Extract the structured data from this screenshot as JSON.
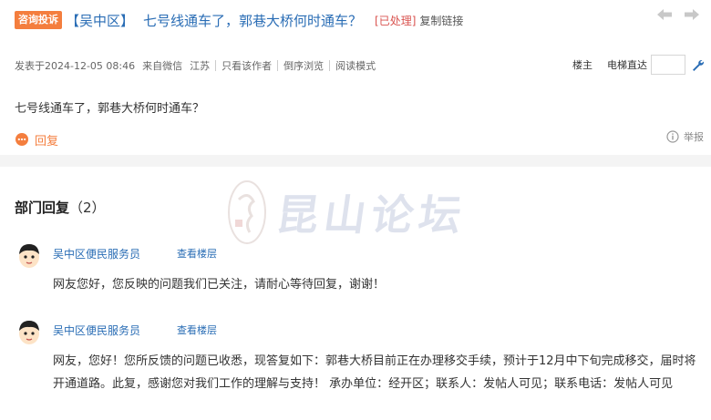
{
  "post": {
    "tag": "咨询投诉",
    "district": "【吴中区】",
    "title": "七号线通车了，郭巷大桥何时通车？",
    "status": "[已处理]",
    "copy_link": "复制链接",
    "meta": {
      "posted": "发表于2024-12-05 08:46",
      "source": "来自微信",
      "region": "江苏",
      "only_author": "只看该作者",
      "reverse": "倒序浏览",
      "read_mode": "阅读模式",
      "floor_owner": "楼主",
      "elevator": "电梯直达"
    },
    "content": "七号线通车了，郭巷大桥何时通车？",
    "reply_label": "回复",
    "report_label": "举报"
  },
  "department": {
    "title": "部门回复",
    "count": "（2）",
    "replies": [
      {
        "name": "吴中区便民服务员",
        "view_floor": "查看楼层",
        "text": "网友您好，您反映的问题我们已关注，请耐心等待回复，谢谢！"
      },
      {
        "name": "吴中区便民服务员",
        "view_floor": "查看楼层",
        "text": "网友，您好！您所反馈的问题已收悉，现答复如下：郭巷大桥目前正在办理移交手续，预计于12月中下旬完成移交，届时将开通道路。此复，感谢您对我们工作的理解与支持！ 承办单位：经开区；联系人：发帖人可见；联系电话：发帖人可见"
      }
    ]
  },
  "watermark": "昆山论坛",
  "colors": {
    "accent_orange": "#f47e3e",
    "link_blue": "#2a6db5",
    "status_red": "#d9534f"
  },
  "icons": [
    "arrow-left-icon",
    "arrow-right-icon",
    "wrench-icon",
    "reply-icon",
    "info-icon",
    "avatar-icon"
  ]
}
